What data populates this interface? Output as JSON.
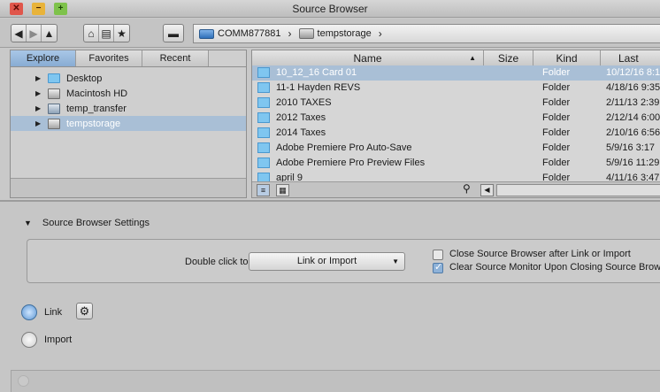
{
  "window": {
    "title": "Source Browser",
    "close_label": "✕",
    "min_label": "−",
    "max_label": "+"
  },
  "toolbar": {
    "back_label": "◀",
    "forward_label": "▶",
    "up_label": "▲",
    "home_label": "⌂",
    "list_label": "▤",
    "star_label": "★",
    "drive_label": "▬"
  },
  "breadcrumb": [
    {
      "label": "COMM877881",
      "icon": "blue-drive-icon"
    },
    {
      "label": "tempstorage",
      "icon": "grey-drive-icon"
    }
  ],
  "breadcrumb_sep": "›",
  "left_panel": {
    "tabs": [
      "Explore",
      "Favorites",
      "Recent"
    ],
    "active_tab": "Explore",
    "tree": [
      {
        "label": "Desktop",
        "icon": "folder-icon",
        "selected": false
      },
      {
        "label": "Macintosh HD",
        "icon": "hard-drive-icon",
        "selected": false
      },
      {
        "label": "temp_transfer",
        "icon": "network-drive-icon",
        "selected": false
      },
      {
        "label": "tempstorage",
        "icon": "hard-drive-icon",
        "selected": true
      }
    ]
  },
  "file_list": {
    "columns": {
      "name": "Name",
      "size": "Size",
      "kind": "Kind",
      "last_modified": "Last Mod"
    },
    "sort_indicator": "▲",
    "rows": [
      {
        "name": "10_12_16 Card 01",
        "kind": "Folder",
        "modified": "10/12/16 8:1",
        "selected": true
      },
      {
        "name": "11-1 Hayden REVS",
        "kind": "Folder",
        "modified": "4/18/16 9:35",
        "selected": false
      },
      {
        "name": "2010 TAXES",
        "kind": "Folder",
        "modified": "2/11/13 2:39",
        "selected": false
      },
      {
        "name": "2012 Taxes",
        "kind": "Folder",
        "modified": "2/12/14 6:00",
        "selected": false
      },
      {
        "name": "2014 Taxes",
        "kind": "Folder",
        "modified": "2/10/16 6:56",
        "selected": false
      },
      {
        "name": "Adobe Premiere Pro Auto-Save",
        "kind": "Folder",
        "modified": "5/9/16 3:17",
        "selected": false
      },
      {
        "name": "Adobe Premiere Pro Preview Files",
        "kind": "Folder",
        "modified": "5/9/16 11:29",
        "selected": false
      },
      {
        "name": "april 9",
        "kind": "Folder",
        "modified": "4/11/16 3:47",
        "selected": false
      }
    ]
  },
  "settings": {
    "section_title": "Source Browser Settings",
    "double_click_label": "Double click to:",
    "double_click_value": "Link or Import",
    "close_after_link_label": "Close Source Browser after Link or Import",
    "close_after_link_checked": false,
    "clear_monitor_label": "Clear Source Monitor Upon Closing Source Browser",
    "clear_monitor_checked": true
  },
  "mode": {
    "link_label": "Link",
    "import_label": "Import",
    "selected": "Link"
  }
}
